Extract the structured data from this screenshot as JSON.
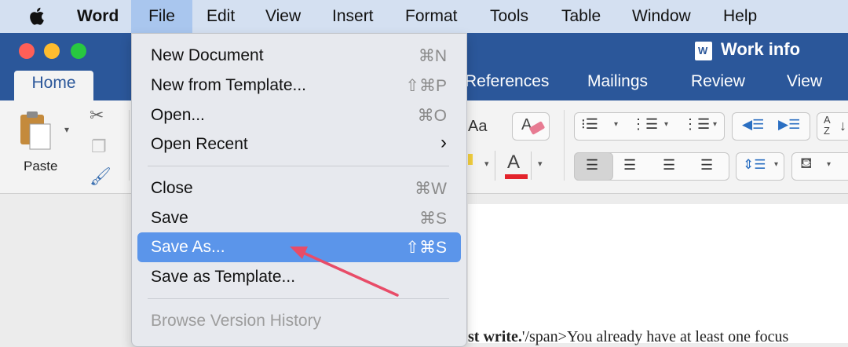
{
  "menubar": {
    "app": "Word",
    "items": [
      "File",
      "Edit",
      "View",
      "Insert",
      "Format",
      "Tools",
      "Table",
      "Window",
      "Help"
    ]
  },
  "window": {
    "title": "Work info",
    "doc_icon_letter": "W"
  },
  "ribbon": {
    "tabs": [
      "Home",
      "References",
      "Mailings",
      "Review",
      "View"
    ],
    "paste_label": "Paste",
    "font_label": "Aa",
    "font_color_label": "A",
    "sort_label": "A Z"
  },
  "file_menu": {
    "items": [
      {
        "label": "New Document",
        "shortcut": "⌘N"
      },
      {
        "label": "New from Template...",
        "shortcut": "⇧⌘P"
      },
      {
        "label": "Open...",
        "shortcut": "⌘O"
      },
      {
        "label": "Open Recent",
        "shortcut": "›"
      },
      {
        "label": "Close",
        "shortcut": "⌘W"
      },
      {
        "label": "Save",
        "shortcut": "⌘S"
      },
      {
        "label": "Save As...",
        "shortcut": "⇧⌘S"
      },
      {
        "label": "Save as Template...",
        "shortcut": ""
      },
      {
        "label": "Browse Version History",
        "shortcut": ""
      }
    ]
  },
  "document": {
    "bold_text": "st write.",
    "plain_text": "'/span>You already have at least one focus"
  },
  "colors": {
    "accent": "#2b579a",
    "highlight": "#5b95ea",
    "arrow": "#e84c68",
    "font_color_bar": "#e3232b"
  }
}
